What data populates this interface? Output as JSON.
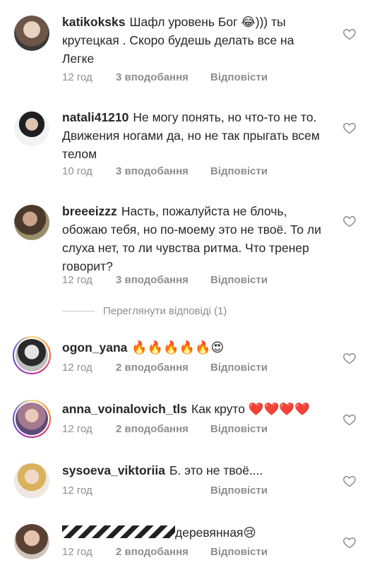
{
  "labels": {
    "view_replies": "Переглянути відповіді (1)"
  },
  "comments": [
    {
      "username": "katikoksks",
      "text": "Шафл уровень Бог 😂))) ты крутецкая . Скоро будешь делать все на Легке",
      "time": "12 год",
      "likes": "3 вподобання",
      "reply": "Відповісти",
      "story_ring": false
    },
    {
      "username": "natali41210",
      "text": "Не могу понять, но что-то не то. Движения ногами да, но не так прыгать всем телом",
      "time": "10 год",
      "likes": "3 вподобання",
      "reply": "Відповісти",
      "story_ring": false
    },
    {
      "username": "breeeizzz",
      "text": "Насть, пожалуйста не блочь, обожаю тебя, но по-моему это не твоё. То ли слуха нет, то ли чувства ритма. Что тренер говорит?",
      "time": "12 год",
      "likes": "3 вподобання",
      "reply": "Відповісти",
      "story_ring": false
    },
    {
      "username": "ogon_yana",
      "text": "🔥🔥🔥🔥🔥😍",
      "time": "12 год",
      "likes": "2 вподобання",
      "reply": "Відповісти",
      "story_ring": true
    },
    {
      "username": "anna_voinalovich_tls",
      "text": "Как круто ❤️❤️❤️❤️",
      "time": "12 год",
      "likes": "2 вподобання",
      "reply": "Відповісти",
      "story_ring": true
    },
    {
      "username": "sysoeva_viktoriia",
      "text": "Б. это не твоё....",
      "time": "12 год",
      "likes": "",
      "reply": "Відповісти",
      "story_ring": false
    },
    {
      "username": "",
      "text": "деревянная😢",
      "time": "12 год",
      "likes": "2 вподобання",
      "reply": "Відповісти",
      "story_ring": false
    }
  ],
  "colors": {
    "text": "#262626",
    "meta": "#8e8e8e",
    "background": "#ffffff"
  }
}
